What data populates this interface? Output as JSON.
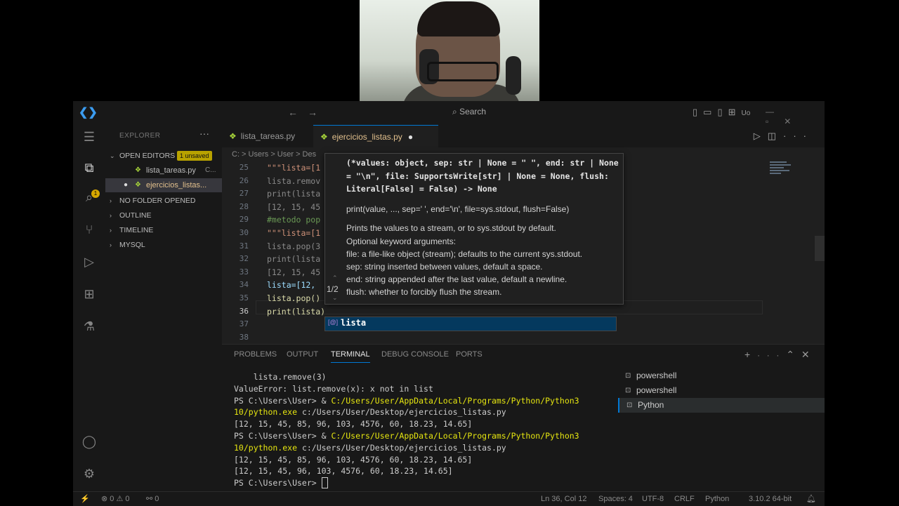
{
  "titlebar": {
    "search_label": "Search",
    "account_label": "Uo"
  },
  "sidebar": {
    "title": "EXPLORER",
    "open_editors_label": "OPEN EDITORS",
    "unsaved_badge": "1 unsaved",
    "activity_badge": "1",
    "files": [
      {
        "name": "lista_tareas.py",
        "dir": "C..."
      },
      {
        "name": "ejercicios_listas...",
        "dir": ""
      }
    ],
    "sections": [
      "NO FOLDER OPENED",
      "OUTLINE",
      "TIMELINE",
      "MYSQL"
    ]
  },
  "editor": {
    "tabs": [
      {
        "label": "lista_tareas.py"
      },
      {
        "label": "ejercicios_listas.py"
      }
    ],
    "breadcrumb": "C: > Users > User > Des",
    "lines": [
      {
        "n": "25",
        "text": "\"\"\"lista=[1",
        "color": "#ce9178"
      },
      {
        "n": "26",
        "text": "lista.remov",
        "color": "#8a8a8a"
      },
      {
        "n": "27",
        "text": "print(lista",
        "color": "#8a8a8a"
      },
      {
        "n": "28",
        "text": "[12, 15, 45",
        "color": "#8a8a8a"
      },
      {
        "n": "29",
        "text": "#metodo pop",
        "color": "#6a9955"
      },
      {
        "n": "30",
        "text": "\"\"\"lista=[1",
        "color": "#ce9178"
      },
      {
        "n": "31",
        "text": "lista.pop(3",
        "color": "#8a8a8a"
      },
      {
        "n": "32",
        "text": "print(lista",
        "color": "#8a8a8a"
      },
      {
        "n": "33",
        "text": "[12, 15, 45",
        "color": "#8a8a8a"
      },
      {
        "n": "34",
        "text": "lista=[12,",
        "color": "#9cdcfe"
      },
      {
        "n": "35",
        "text": "lista.pop()",
        "color": "#dcdcaa"
      },
      {
        "n": "36",
        "text": "print(lista)",
        "color": "#dcdcaa"
      },
      {
        "n": "37",
        "text": "",
        "color": "#ccc"
      },
      {
        "n": "38",
        "text": "",
        "color": "#ccc"
      }
    ]
  },
  "hover": {
    "signature": "(*values: object, sep: str | None = \" \", end: str | None = \"\\n\", file: SupportsWrite[str] | None = None, flush: Literal[False] = False) -> None",
    "usage": "print(value, ..., sep=' ', end='\\n', file=sys.stdout, flush=False)",
    "doc": [
      "Prints the values to a stream, or to sys.stdout by default.",
      "Optional keyword arguments:",
      "file: a file-like object (stream); defaults to the current sys.stdout.",
      "sep: string inserted between values, default a space.",
      "end: string appended after the last value, default a newline.",
      "flush: whether to forcibly flush the stream."
    ],
    "overload_counter": "1/2"
  },
  "suggest": {
    "item": "lista",
    "icon": "[@]"
  },
  "panel": {
    "tabs": [
      "PROBLEMS",
      "OUTPUT",
      "TERMINAL",
      "DEBUG CONSOLE",
      "PORTS"
    ],
    "terminal_lines": [
      {
        "pre": "    lista.remove(3)",
        "hl": "",
        "post": ""
      },
      {
        "pre": "ValueError: list.remove(x): x not in list",
        "hl": "",
        "post": ""
      },
      {
        "pre": "PS C:\\Users\\User> & ",
        "hl": "C:/Users/User/AppData/Local/Programs/Python/Python3",
        "post": ""
      },
      {
        "pre": "",
        "hl": "10/python.exe",
        "post": " c:/Users/User/Desktop/ejercicios_listas.py"
      },
      {
        "pre": "[12, 15, 45, 85, 96, 103, 4576, 60, 18.23, 14.65]",
        "hl": "",
        "post": ""
      },
      {
        "pre": "PS C:\\Users\\User> & ",
        "hl": "C:/Users/User/AppData/Local/Programs/Python/Python3",
        "post": ""
      },
      {
        "pre": "",
        "hl": "10/python.exe",
        "post": " c:/Users/User/Desktop/ejercicios_listas.py"
      },
      {
        "pre": "[12, 15, 45, 85, 96, 103, 4576, 60, 18.23, 14.65]",
        "hl": "",
        "post": ""
      },
      {
        "pre": "[12, 15, 45, 96, 103, 4576, 60, 18.23, 14.65]",
        "hl": "",
        "post": ""
      },
      {
        "pre": "PS C:\\Users\\User> ",
        "hl": "",
        "post": ""
      }
    ],
    "terminals": [
      "powershell",
      "powershell",
      "Python"
    ]
  },
  "statusbar": {
    "problems": "⊗ 0 ⚠ 0",
    "ports": "⚯ 0",
    "position": "Ln 36, Col 12",
    "spaces": "Spaces: 4",
    "encoding": "UTF-8",
    "eol": "CRLF",
    "language": "Python",
    "interpreter": "3.10.2 64-bit"
  }
}
